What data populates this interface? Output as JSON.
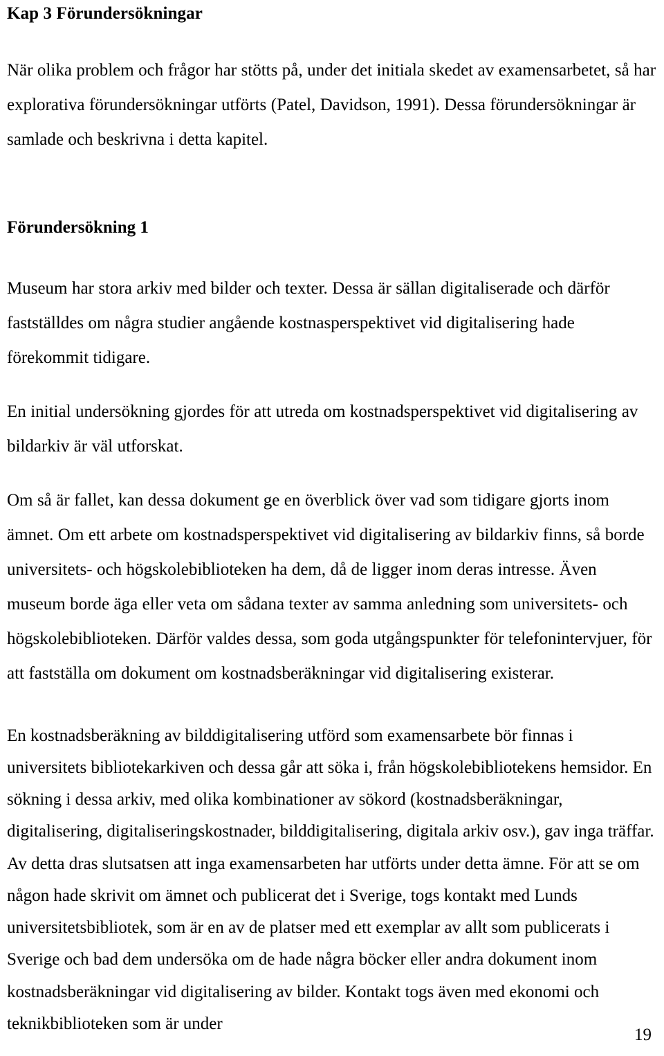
{
  "document": {
    "language": "Swedish",
    "page_number": "19",
    "chapter_heading": "Kap 3 Förundersökningar",
    "section_heading": "Förundersökning 1",
    "paragraphs": {
      "intro": "När olika problem och frågor har stötts på, under det initiala skedet av examensarbetet, så har explorativa förundersökningar utförts (Patel, Davidson, 1991). Dessa förundersökningar är samlade och beskrivna i detta kapitel.",
      "p1": "Museum har stora arkiv med bilder och texter. Dessa är sällan digitaliserade och därför fastställdes om några studier angående kostnasperspektivet vid digitalisering hade förekommit tidigare.",
      "p2": "En initial undersökning gjordes för att utreda om kostnadsperspektivet vid digitalisering av bildarkiv är väl utforskat.",
      "p3": "Om så är fallet, kan dessa dokument ge en överblick över vad som tidigare gjorts inom ämnet. Om ett arbete om kostnadsperspektivet vid digitalisering av bildarkiv finns, så borde universitets- och högskolebiblioteken ha dem, då de ligger inom deras intresse. Även museum borde äga eller veta om sådana texter av samma anledning som universitets- och högskolebiblioteken. Därför valdes dessa, som goda utgångspunkter för telefonintervjuer, för att fastställa om dokument om kostnadsberäkningar vid digitalisering existerar.",
      "p4": "En kostnadsberäkning av bilddigitalisering utförd som examensarbete bör finnas i universitets bibliotekarkiven och dessa går att söka i, från högskolebibliotekens hemsidor. En sökning i dessa arkiv, med olika kombinationer av sökord (kostnadsberäkningar, digitalisering, digitaliseringskostnader, bilddigitalisering, digitala arkiv osv.), gav inga träffar. Av detta dras slutsatsen att inga examensarbeten har utförts under detta ämne. För att se om någon hade skrivit om ämnet och publicerat det i Sverige, togs kontakt med Lunds universitetsbibliotek, som är en av de platser med ett exemplar av allt som publicerats i Sverige och bad dem undersöka om de hade några böcker eller andra dokument inom kostnadsberäkningar vid digitalisering av bilder. Kontakt togs även med ekonomi och teknikbiblioteken som är under"
    },
    "colors": {
      "text": "#000000",
      "background": "#ffffff"
    }
  }
}
